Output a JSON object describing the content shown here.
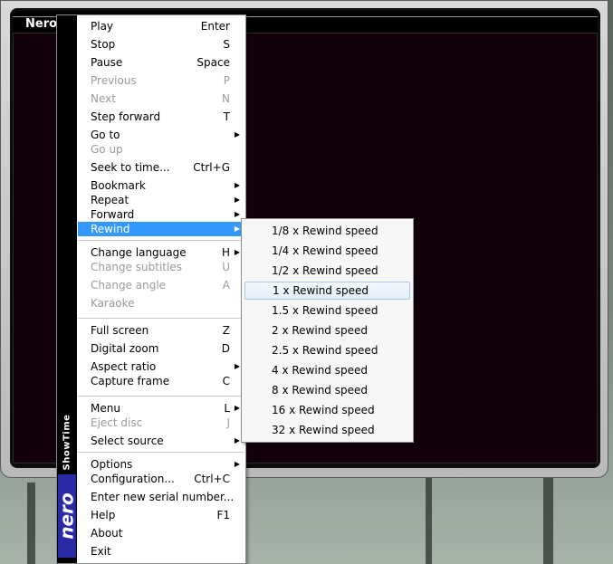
{
  "window": {
    "title": "Nero"
  },
  "menu": {
    "brand_showtime": "ShowTime",
    "brand_nero": "nero",
    "items": [
      {
        "label": "Play",
        "key": "Enter",
        "disabled": false,
        "submenu": false
      },
      {
        "label": "Stop",
        "key": "S",
        "disabled": false,
        "submenu": false
      },
      {
        "label": "Pause",
        "key": "Space",
        "disabled": false,
        "submenu": false
      },
      {
        "label": "Previous",
        "key": "P",
        "disabled": true,
        "submenu": false
      },
      {
        "label": "Next",
        "key": "N",
        "disabled": true,
        "submenu": false
      },
      {
        "label": "Step forward",
        "key": "T",
        "disabled": false,
        "submenu": false
      },
      {
        "label": "Go to",
        "key": "",
        "disabled": false,
        "submenu": true
      },
      {
        "label": "Go up",
        "key": "",
        "disabled": true,
        "submenu": false
      },
      {
        "label": "Seek to time...",
        "key": "Ctrl+G",
        "disabled": false,
        "submenu": false
      },
      {
        "label": "Bookmark",
        "key": "",
        "disabled": false,
        "submenu": true
      },
      {
        "label": "Repeat",
        "key": "",
        "disabled": false,
        "submenu": true
      },
      {
        "label": "Forward",
        "key": "",
        "disabled": false,
        "submenu": true
      },
      {
        "label": "Rewind",
        "key": "",
        "disabled": false,
        "submenu": true,
        "active": true
      },
      {
        "label": "Change language",
        "key": "H",
        "disabled": false,
        "submenu": true
      },
      {
        "label": "Change subtitles",
        "key": "U",
        "disabled": true,
        "submenu": false
      },
      {
        "label": "Change angle",
        "key": "A",
        "disabled": true,
        "submenu": false
      },
      {
        "label": "Karaoke",
        "key": "",
        "disabled": true,
        "submenu": false
      },
      {
        "label": "Full screen",
        "key": "Z",
        "disabled": false,
        "submenu": false
      },
      {
        "label": "Digital zoom",
        "key": "D",
        "disabled": false,
        "submenu": false
      },
      {
        "label": "Aspect ratio",
        "key": "",
        "disabled": false,
        "submenu": true
      },
      {
        "label": "Capture frame",
        "key": "C",
        "disabled": false,
        "submenu": false
      },
      {
        "label": "Menu",
        "key": "L",
        "disabled": false,
        "submenu": true
      },
      {
        "label": "Eject disc",
        "key": "J",
        "disabled": true,
        "submenu": false
      },
      {
        "label": "Select source",
        "key": "",
        "disabled": false,
        "submenu": true
      },
      {
        "label": "Options",
        "key": "",
        "disabled": false,
        "submenu": true
      },
      {
        "label": "Configuration...",
        "key": "Ctrl+C",
        "disabled": false,
        "submenu": false
      },
      {
        "label": "Enter new serial number...",
        "key": "",
        "disabled": false,
        "submenu": false
      },
      {
        "label": "Help",
        "key": "F1",
        "disabled": false,
        "submenu": false
      },
      {
        "label": "About",
        "key": "",
        "disabled": false,
        "submenu": false
      },
      {
        "label": "Exit",
        "key": "",
        "disabled": false,
        "submenu": false
      }
    ]
  },
  "rewind_submenu": {
    "items": [
      {
        "label": "1/8 x Rewind speed"
      },
      {
        "label": "1/4 x Rewind speed"
      },
      {
        "label": "1/2 x Rewind speed"
      },
      {
        "label": "1 x Rewind speed",
        "hover": true
      },
      {
        "label": "1.5 x Rewind speed"
      },
      {
        "label": "2 x Rewind speed"
      },
      {
        "label": "2.5 x Rewind speed"
      },
      {
        "label": "4 x Rewind speed"
      },
      {
        "label": "8 x Rewind speed"
      },
      {
        "label": "16 x Rewind speed"
      },
      {
        "label": "32 x Rewind speed"
      }
    ]
  },
  "colors": {
    "highlight": "#3399ff",
    "disabled_text": "#9a9a9a",
    "video_bg": "#12000a"
  }
}
